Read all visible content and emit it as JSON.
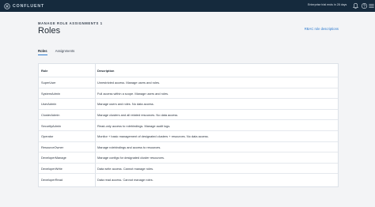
{
  "topbar": {
    "logo_text": "CONFLUENT",
    "trial_text": "Enterprise trial ends in 28 days",
    "icons": [
      "bell-icon",
      "help-icon",
      "menu-icon"
    ]
  },
  "header": {
    "breadcrumb": "MANAGE ROLE ASSIGNMENTS 1",
    "title": "Roles",
    "rbac_link": "RBAC role descriptions"
  },
  "tabs": [
    {
      "label": "Roles",
      "active": true
    },
    {
      "label": "Assignments",
      "active": false
    }
  ],
  "table": {
    "columns": [
      "Role",
      "Description"
    ],
    "rows": [
      {
        "role": "SuperUser",
        "description": "Unrestricted access. Manage users and roles."
      },
      {
        "role": "SystemAdmin",
        "description": "Full access within a scope. Manage users and roles."
      },
      {
        "role": "UserAdmin",
        "description": "Manage users and roles. No data access."
      },
      {
        "role": "ClusterAdmin",
        "description": "Manage clusters and all related resources. No data access."
      },
      {
        "role": "SecurityAdmin",
        "description": "Read-only access to rolebindings. Manage audit logs."
      },
      {
        "role": "Operator",
        "description": "Monitor + basic management of designated clusters + resources. No data access."
      },
      {
        "role": "ResourceOwner",
        "description": "Manage rolebindings and access to resources."
      },
      {
        "role": "DeveloperManage",
        "description": "Manage configs for designated cluster resources."
      },
      {
        "role": "DeveloperWrite",
        "description": "Data write access. Cannot manage roles."
      },
      {
        "role": "DeveloperRead",
        "description": "Data read access. Cannot manage roles."
      }
    ]
  },
  "colors": {
    "topbar_bg": "#152a3d",
    "page_bg": "#f3f4f6",
    "link": "#2e7bcf",
    "border": "#dde2e8"
  }
}
